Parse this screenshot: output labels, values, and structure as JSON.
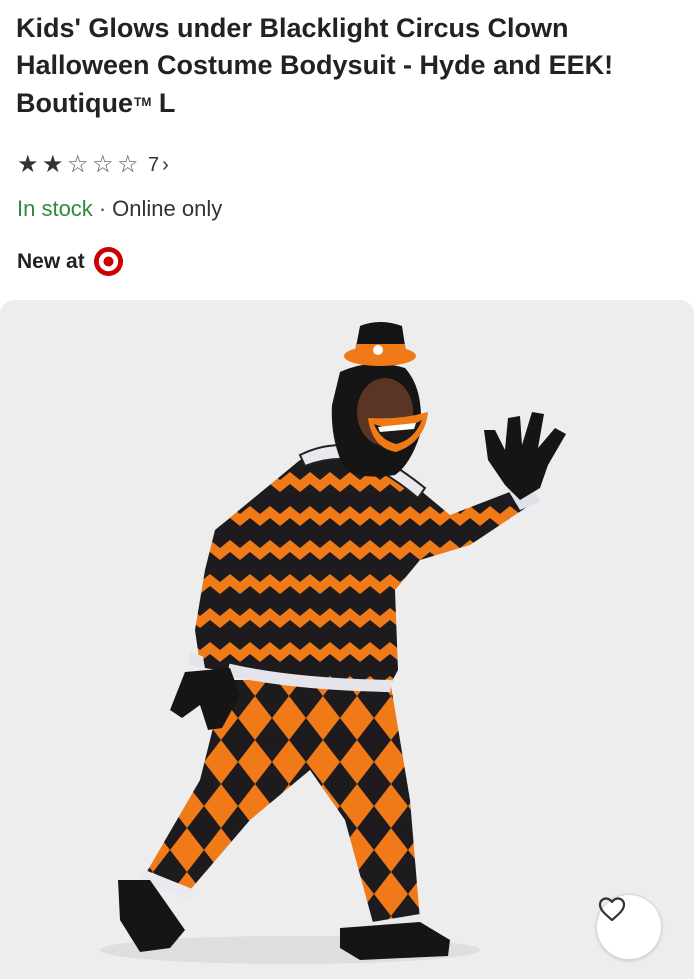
{
  "product": {
    "title_main": "Kids' Glows under Blacklight Circus Clown Halloween Costume Bodysuit - Hyde and EEK! Boutique",
    "trademark": "TM",
    "size_suffix": "L",
    "rating": {
      "filled_stars": 2,
      "total_stars": 5,
      "review_count": "7",
      "chevron": "›"
    },
    "availability": {
      "stock": "In stock",
      "separator": "·",
      "channel": "Online only"
    },
    "new_label": "New at",
    "brand_logo_icon": "target-bullseye-icon",
    "brand_color": "#cc0000"
  },
  "image": {
    "description_icon": "costume-photo",
    "background": "#ededed"
  },
  "favorite": {
    "icon": "heart-icon"
  }
}
